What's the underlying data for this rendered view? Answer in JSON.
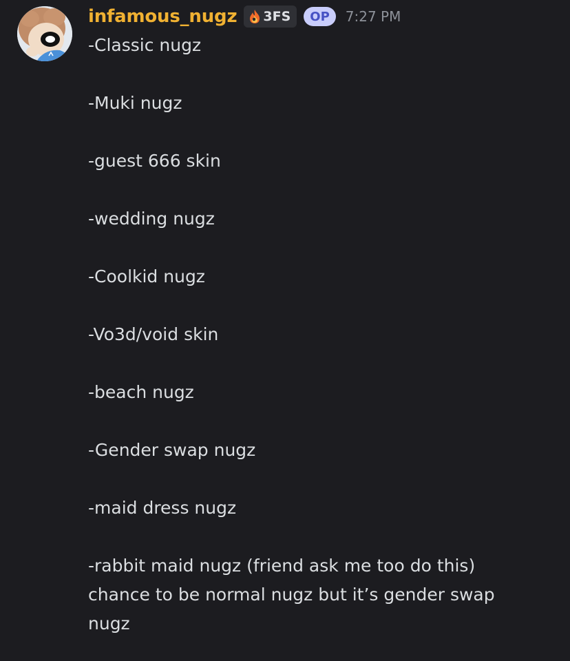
{
  "message": {
    "author": {
      "username": "infamous_nugz",
      "color": "#f0b132",
      "avatar": "avatar-icon"
    },
    "guild_tag": {
      "icon": "fire-icon",
      "text": "3FS"
    },
    "op_badge": "OP",
    "timestamp": "7:27 PM",
    "lines": [
      "-Classic nugz",
      "-Muki nugz",
      "-guest 666 skin",
      "-wedding nugz",
      "-Coolkid nugz",
      "-Vo3d/void skin",
      "-beach nugz",
      "-Gender swap nugz",
      "-maid dress nugz"
    ],
    "last_paragraph": [
      "-rabbit maid nugz (friend ask me too do this)",
      "chance to be normal nugz but it’s gender swap",
      "nugz"
    ]
  },
  "colors": {
    "background": "#1c1c20",
    "text": "#dbdee1",
    "timestamp": "#8d9199",
    "op_badge_bg": "#c9cdfb",
    "op_badge_text": "#4752c4",
    "tag_bg": "#2f3035"
  }
}
